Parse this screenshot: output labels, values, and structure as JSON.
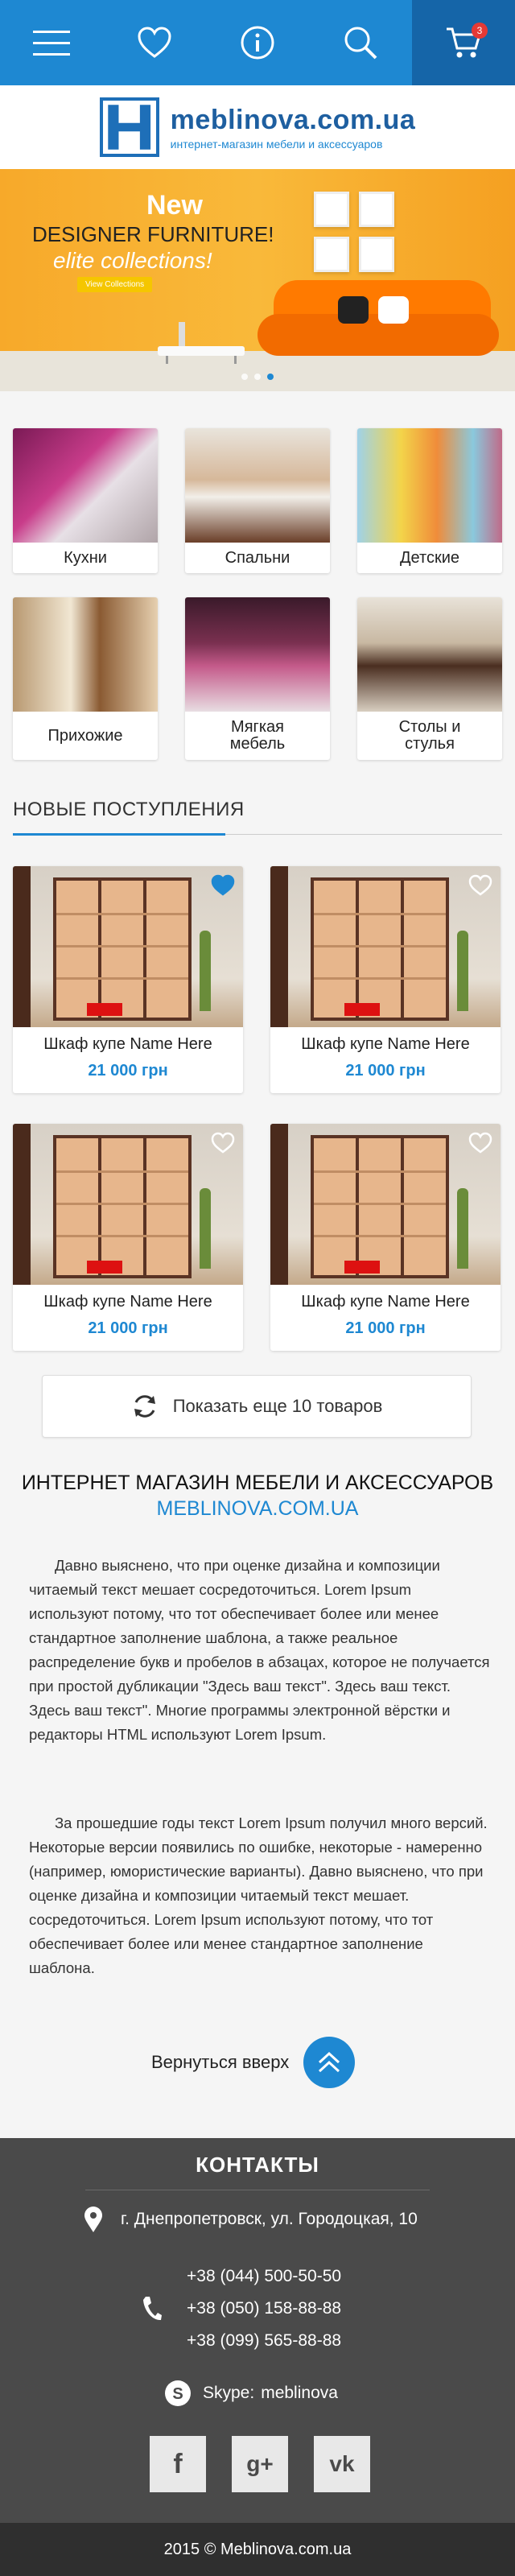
{
  "header": {
    "cart_count": "3",
    "icons": [
      "menu-icon",
      "heart-icon",
      "info-icon",
      "search-icon",
      "cart-icon"
    ]
  },
  "logo": {
    "letter": "H",
    "name": "meblinova.com.ua",
    "tagline": "интернет-магазин мебели и аксессуаров"
  },
  "banner": {
    "new": "New",
    "title": "DESIGNER FURNITURE!",
    "subtitle": "elite collections!",
    "button": "View Collections"
  },
  "categories": [
    {
      "label": "Кухни"
    },
    {
      "label": "Спальни"
    },
    {
      "label": "Детские"
    },
    {
      "label": "Прихожие"
    },
    {
      "label": "Мягкая мебель"
    },
    {
      "label": "Столы и стулья"
    }
  ],
  "new_arrivals": {
    "title": "НОВЫЕ ПОСТУПЛЕНИЯ",
    "products": [
      {
        "name": "Шкаф купе Name Here",
        "price": "21 000 грн",
        "favorite": true
      },
      {
        "name": "Шкаф купе Name Here",
        "price": "21 000 грн",
        "favorite": false
      },
      {
        "name": "Шкаф купе Name Here",
        "price": "21 000 грн",
        "favorite": false
      },
      {
        "name": "Шкаф купе Name Here",
        "price": "21 000 грн",
        "favorite": false
      }
    ],
    "more_label": "Показать еще 10 товаров"
  },
  "about": {
    "title": "ИНТЕРНЕТ МАГАЗИН МЕБЕЛИ И АКСЕССУАРОВ",
    "site": "MEBLINOVA.COM.UA",
    "p1": "Давно выяснено, что при оценке дизайна и композиции читаемый текст мешает сосредоточиться. Lorem Ipsum используют потому, что тот обеспечивает более или менее стандартное заполнение шаблона, а также реальное распределение букв и пробелов в абзацах, которое не получается при простой дубликации \"Здесь ваш текст\". Здесь ваш текст. Здесь ваш текст\". Многие программы электронной вёрстки и редакторы HTML используют Lorem Ipsum.",
    "p2": "За прошедшие годы текст Lorem Ipsum получил много версий. Некоторые версии появились по ошибке, некоторые - намеренно (например, юмористические варианты). Давно выяснено, что при оценке дизайна и композиции читаемый текст мешает. сосредоточиться. Lorem Ipsum используют потому, что тот обеспечивает более или менее стандартное заполнение шаблона.",
    "back_to_top": "Вернуться вверх"
  },
  "footer": {
    "title": "КОНТАКТЫ",
    "address": "г. Днепропетровск, ул. Городоцкая, 10",
    "phones": [
      "+38 (044) 500-50-50",
      "+38 (050) 158-88-88",
      "+38 (099) 565-88-88"
    ],
    "skype_label": "Skype:",
    "skype": "meblinova",
    "socials": [
      "f",
      "g+",
      "vk"
    ],
    "copyright": "2015  ©  Meblinova.com.ua"
  },
  "colors": {
    "primary": "#1e88d2",
    "primary_dark": "#1565a8",
    "footer_bg": "#4a4a4a",
    "copyright_bg": "#2f2f2f"
  }
}
